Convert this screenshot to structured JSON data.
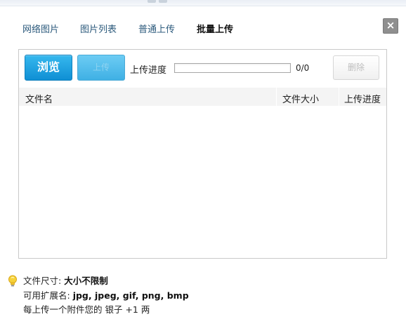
{
  "tabs": [
    {
      "label": "网络图片",
      "active": false
    },
    {
      "label": "图片列表",
      "active": false
    },
    {
      "label": "普通上传",
      "active": false
    },
    {
      "label": "批量上传",
      "active": true
    }
  ],
  "close_label": "×",
  "uploader": {
    "browse_label": "浏览",
    "upload_label": "上传",
    "progress_label": "上传进度",
    "progress_value": 0,
    "progress_count": "0/0",
    "delete_label": "删除"
  },
  "table": {
    "columns": [
      "文件名",
      "文件大小",
      "上传进度"
    ],
    "rows": []
  },
  "info": {
    "size_label": "文件尺寸:",
    "size_value": "大小不限制",
    "ext_label": "可用扩展名:",
    "ext_value": "jpg, jpeg, gif, png, bmp",
    "reward_text": "每上传一个附件您的 银子 +1 两"
  },
  "colors": {
    "accent": "#1a9fe0",
    "tab_link": "#2c5a7c",
    "panel_border": "#c9c9c9"
  }
}
